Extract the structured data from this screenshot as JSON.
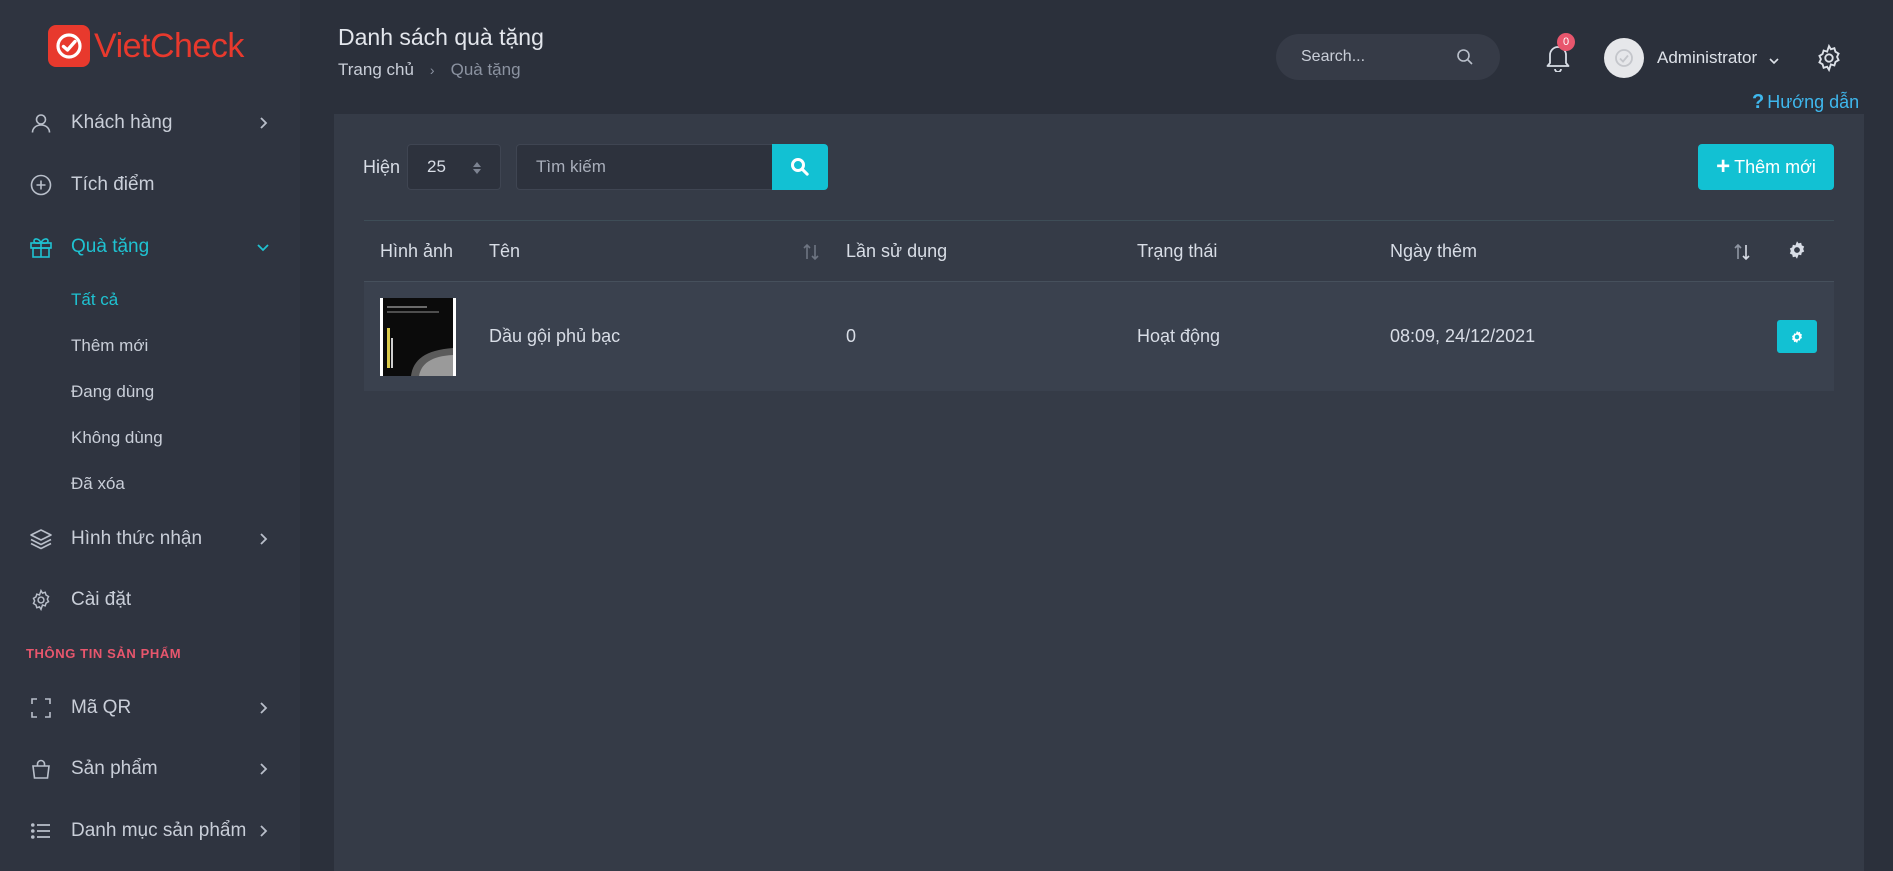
{
  "app": {
    "logo_text": "VietCheck"
  },
  "sidebar": {
    "items": [
      {
        "label": "Khách hàng",
        "icon": "user-icon"
      },
      {
        "label": "Tích điểm",
        "icon": "plus-circle-icon"
      },
      {
        "label": "Quà tặng",
        "icon": "gift-icon"
      },
      {
        "label": "Hình thức nhận",
        "icon": "layers-icon"
      },
      {
        "label": "Cài đặt",
        "icon": "gear-icon"
      }
    ],
    "gift_submenu": [
      "Tất cả",
      "Thêm mới",
      "Đang dùng",
      "Không dùng",
      "Đã xóa"
    ],
    "section_label": "THÔNG TIN SẢN PHẨM",
    "product_items": [
      {
        "label": "Mã QR",
        "icon": "qr-scan-icon"
      },
      {
        "label": "Sản phẩm",
        "icon": "shopping-bag-icon"
      },
      {
        "label": "Danh mục sản phẩm",
        "icon": "list-icon"
      }
    ]
  },
  "header": {
    "title": "Danh sách quà tặng",
    "breadcrumb": {
      "home": "Trang chủ",
      "separator": "›",
      "current": "Quà tặng"
    },
    "search_placeholder": "Search...",
    "notification_count": "0",
    "user_name": "Administrator",
    "help_label": "Hướng dẫn"
  },
  "toolbar": {
    "show_label": "Hiện",
    "page_size": "25",
    "search_placeholder": "Tìm kiếm",
    "add_label": "Thêm mới"
  },
  "table": {
    "columns": [
      "Hình ảnh",
      "Tên",
      "Lần sử dụng",
      "Trạng thái",
      "Ngày thêm"
    ],
    "rows": [
      {
        "name": "Dầu gội phủ bạc",
        "uses": "0",
        "status": "Hoạt động",
        "date_added": "08:09, 24/12/2021"
      }
    ]
  },
  "colors": {
    "accent": "#12c1d3",
    "brand": "#e8392d",
    "sidebar_bg": "#2f3440",
    "page_bg": "#2b303b",
    "card_bg": "#353b47",
    "section_label": "#e8566d",
    "help_link": "#3fb8ee"
  }
}
